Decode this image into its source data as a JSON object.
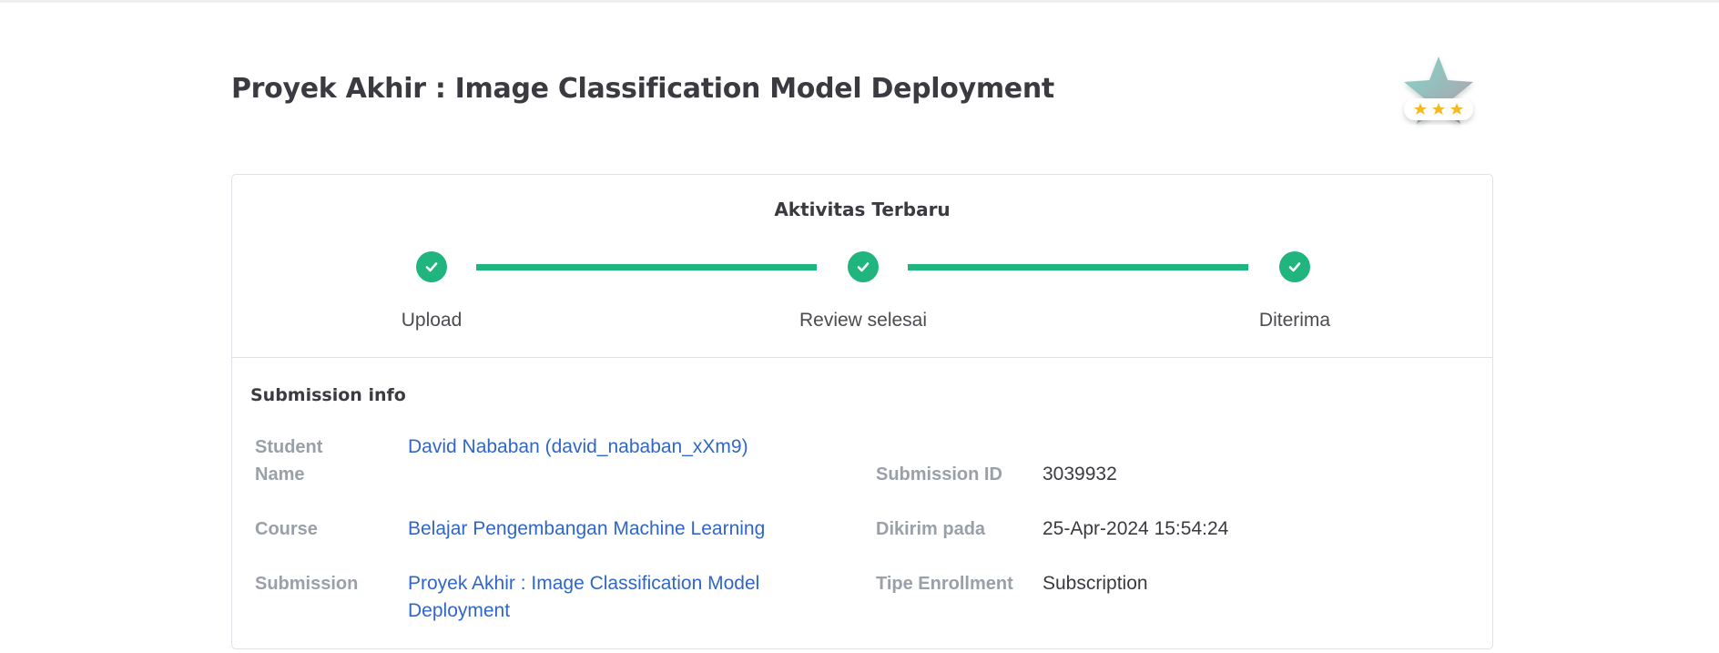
{
  "page": {
    "title": "Proyek Akhir : Image Classification Model Deployment"
  },
  "badge": {
    "icon": "star-rating-badge-icon",
    "stars": 3,
    "colors": {
      "star_gradient_from": "#7fd8cc",
      "star_gradient_to": "#b59aa6",
      "rating_star": "#f5b820"
    }
  },
  "activity": {
    "title": "Aktivitas Terbaru",
    "accent_color": "#20b47f",
    "steps": [
      {
        "label": "Upload",
        "icon": "check-icon",
        "completed": true
      },
      {
        "label": "Review selesai",
        "icon": "check-icon",
        "completed": true
      },
      {
        "label": "Diterima",
        "icon": "check-icon",
        "completed": true
      }
    ]
  },
  "submission_info": {
    "heading": "Submission info",
    "student_name_label": "Student Name",
    "student_name_value": "David Nababan (david_nababan_xXm9)",
    "course_label": "Course",
    "course_value": "Belajar Pengembangan Machine Learning",
    "submission_label": "Submission",
    "submission_value": "Proyek Akhir : Image Classification Model Deployment",
    "submission_id_label": "Submission ID",
    "submission_id_value": "3039932",
    "sent_at_label": "Dikirim pada",
    "sent_at_value": "25-Apr-2024 15:54:24",
    "enrollment_type_label": "Tipe Enrollment",
    "enrollment_type_value": "Subscription",
    "link_color": "#3166c9"
  }
}
